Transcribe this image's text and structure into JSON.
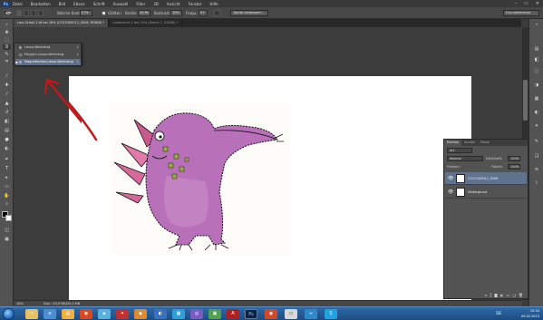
{
  "menu": {
    "logo": "Ps",
    "items": [
      "Datei",
      "Bearbeiten",
      "Bild",
      "Ebene",
      "Schrift",
      "Auswahl",
      "Filter",
      "3D",
      "Ansicht",
      "Fenster",
      "Hilfe"
    ],
    "window_controls": [
      "–",
      "▭",
      "✕"
    ]
  },
  "options": {
    "feather_label": "Weiche Kante:",
    "feather_value": "0 Px",
    "antialias_label": "Glätten",
    "width_label": "Breite:",
    "width_value": "10 Px",
    "contrast_label": "Kontrast:",
    "contrast_value": "10%",
    "frequency_label": "Frequ.:",
    "frequency_value": "57",
    "refine_edge_button": "Kante verbessern...",
    "workspace": "Grundelemente"
  },
  "tabs": [
    {
      "label": "Lars-Scholl-1.tif bei 16% (CCV1000012_0006, RGB/8) *",
      "active": true
    },
    {
      "label": "Unbenannt-1 bei 25% (Ebene 1, RGB/8) *",
      "active": false
    }
  ],
  "flyout": {
    "items": [
      {
        "label": "Lasso-Werkzeug",
        "key": "L",
        "icon": "lasso-icon",
        "selected": false
      },
      {
        "label": "Polygon-Lasso-Werkzeug",
        "key": "L",
        "icon": "polygon-lasso-icon",
        "selected": false
      },
      {
        "label": "Magnetisches-Lasso-Werkzeug",
        "key": "L",
        "icon": "magnetic-lasso-icon",
        "selected": true
      }
    ]
  },
  "layers_panel": {
    "tabs": [
      {
        "label": "Ebenen",
        "active": true
      },
      {
        "label": "Kanäle",
        "active": false
      },
      {
        "label": "Pfade",
        "active": false
      }
    ],
    "filter_label": "Art",
    "blend_mode": "Normal",
    "opacity_label": "Deckkraft:",
    "opacity_value": "100%",
    "lock_label": "Fixieren:",
    "fill_label": "Fläche:",
    "fill_value": "100%",
    "layers": [
      {
        "name": "CCV1000012_0006",
        "selected": true
      },
      {
        "name": "Hintergrund",
        "selected": false
      }
    ]
  },
  "status": {
    "zoom": "16%",
    "doc_info": "Dok.: 29,9 MB/45,0 MB"
  },
  "taskbar": {
    "tray_lang": "DE",
    "time": "15:34",
    "date": "09.02.2015"
  },
  "colors": {
    "accent_selection": "#5f738f",
    "annotation_arrow": "#c0191b",
    "monster_body": "#b870b8"
  }
}
